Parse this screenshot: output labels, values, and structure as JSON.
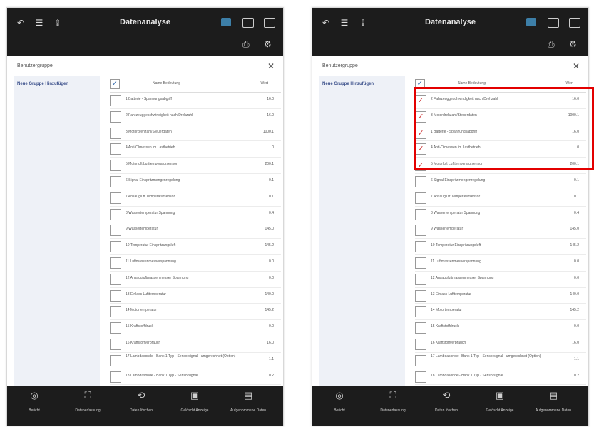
{
  "screens": [
    {
      "app_title": "Datenanalyse",
      "group_label": "Benutzergruppe",
      "sidebar_link": "Neue Gruppe Hinzufügen",
      "col_name": "Name Bedeutung",
      "col_value": "Wert",
      "rows": [
        {
          "label": "1 Batterie - Spannungsabgriff",
          "value": "16.0",
          "checked": false
        },
        {
          "label": "2 Fahrzeuggeschwindigkeit nach Drehzahl",
          "value": "16.0",
          "checked": false
        },
        {
          "label": "3 Motordrehzahl/Steuerdaten",
          "value": "1000.1",
          "checked": false
        },
        {
          "label": "4 Anti-Ölmessen im Lastbetrieb",
          "value": "0",
          "checked": false
        },
        {
          "label": "5 Motorluft Lufttemperatursensor",
          "value": "200.1",
          "checked": false
        },
        {
          "label": "6 Signal Einspritzmengenregelung",
          "value": "0.1",
          "checked": false
        },
        {
          "label": "7 Ansaugluft Temperatursensor",
          "value": "0.1",
          "checked": false
        },
        {
          "label": "8 Wassertemperatur Spannung",
          "value": "0.4",
          "checked": false
        },
        {
          "label": "9 Wassertemperatur",
          "value": "145.0",
          "checked": false
        },
        {
          "label": "10 Temperatur Einspritzungsluft",
          "value": "145.2",
          "checked": false
        },
        {
          "label": "11 Luftmassenmesserspannung",
          "value": "0.0",
          "checked": false
        },
        {
          "label": "12 Ansaugluftmassenmesser Spannung",
          "value": "0.0",
          "checked": false
        },
        {
          "label": "13 Einlass Lufttemperatur",
          "value": "140.0",
          "checked": false
        },
        {
          "label": "14 Motortemperatur",
          "value": "145.2",
          "checked": false
        },
        {
          "label": "15 Kraftstoffdruck",
          "value": "0.0",
          "checked": false
        },
        {
          "label": "16 Kraftstoffverbrauch",
          "value": "16.0",
          "checked": false
        },
        {
          "label": "17 Lambdasonde - Bank 1 Typ - Sensorsignal - umgerechnet (Option)",
          "value": "1.1",
          "checked": false
        },
        {
          "label": "18 Lambdasonde - Bank 1 Typ - Sensorsignal",
          "value": "0.2",
          "checked": false
        }
      ]
    },
    {
      "app_title": "Datenanalyse",
      "group_label": "Benutzergruppe",
      "sidebar_link": "Neue Gruppe Hinzufügen",
      "col_name": "Name Bedeutung",
      "col_value": "Wert",
      "rows": [
        {
          "label": "2 Fahrzeuggeschwindigkeit nach Drehzahl",
          "value": "16.0",
          "checked": true
        },
        {
          "label": "3 Motordrehzahl/Steuerdaten",
          "value": "1000.1",
          "checked": true
        },
        {
          "label": "1 Batterie - Spannungsabgriff",
          "value": "16.0",
          "checked": true
        },
        {
          "label": "4 Anti-Ölmessen im Lastbetrieb",
          "value": "0",
          "checked": true
        },
        {
          "label": "5 Motorluft Lufttemperatursensor",
          "value": "200.1",
          "checked": true
        },
        {
          "label": "6 Signal Einspritzmengenregelung",
          "value": "0.1",
          "checked": false
        },
        {
          "label": "7 Ansaugluft Temperatursensor",
          "value": "0.1",
          "checked": false
        },
        {
          "label": "8 Wassertemperatur Spannung",
          "value": "0.4",
          "checked": false
        },
        {
          "label": "9 Wassertemperatur",
          "value": "145.0",
          "checked": false
        },
        {
          "label": "10 Temperatur Einspritzungsluft",
          "value": "145.2",
          "checked": false
        },
        {
          "label": "11 Luftmassenmesserspannung",
          "value": "0.0",
          "checked": false
        },
        {
          "label": "12 Ansaugluftmassenmesser Spannung",
          "value": "0.0",
          "checked": false
        },
        {
          "label": "13 Einlass Lufttemperatur",
          "value": "140.0",
          "checked": false
        },
        {
          "label": "14 Motortemperatur",
          "value": "145.2",
          "checked": false
        },
        {
          "label": "15 Kraftstoffdruck",
          "value": "0.0",
          "checked": false
        },
        {
          "label": "16 Kraftstoffverbrauch",
          "value": "16.0",
          "checked": false
        },
        {
          "label": "17 Lambdasonde - Bank 1 Typ - Sensorsignal - umgerechnet (Option)",
          "value": "1.1",
          "checked": false
        },
        {
          "label": "18 Lambdasonde - Bank 1 Typ - Sensorsignal",
          "value": "0.2",
          "checked": false
        }
      ]
    }
  ],
  "bottom_nav": [
    "Bericht",
    "Datenerfassung",
    "Daten löschen",
    "Gelöscht Anzeige",
    "Aufgenommene Daten"
  ],
  "icons": {
    "top_left": [
      "back-icon",
      "menu-icon",
      "share-icon"
    ],
    "top_right": [
      "record-icon",
      "expand-icon",
      "grid-icon",
      "print-icon",
      "settings-icon"
    ],
    "bottom": [
      "record-icon",
      "capture-icon",
      "clear-icon",
      "view-icon",
      "saved-data-icon"
    ]
  },
  "colors": {
    "bar": "#1c1c1c",
    "accent": "#3d7fa8",
    "highlight": "#e30000",
    "link": "#3a4f8a"
  }
}
